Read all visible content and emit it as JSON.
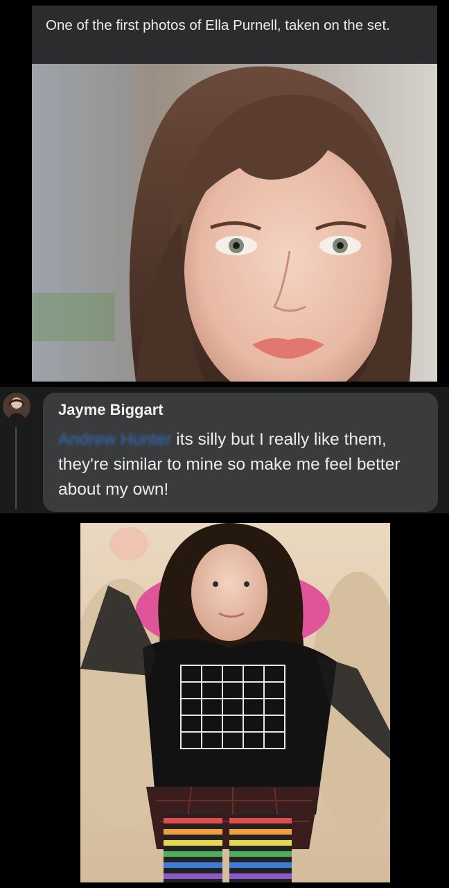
{
  "post": {
    "caption": "One of the first photos of Ella Purnell, taken on the set."
  },
  "comment": {
    "author": "Jayme Biggart",
    "mention": "Andrew Hunter",
    "text": "its silly but I really like them, they're similar to mine so make me feel better about my own!"
  },
  "colors": {
    "background": "#000000",
    "bubble": "#3a3b3d",
    "mention": "#2f6fb8"
  }
}
